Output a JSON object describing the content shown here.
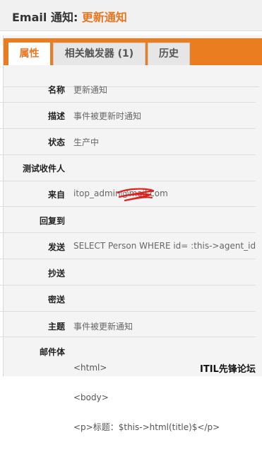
{
  "header": {
    "title_prefix": "Email 通知: ",
    "title_name": "更新通知"
  },
  "tabs": [
    {
      "label": "属性"
    },
    {
      "label": "相关触发器 (1)"
    },
    {
      "label": "历史"
    }
  ],
  "fields": {
    "name": {
      "label": "名称",
      "value": "更新通知"
    },
    "desc": {
      "label": "描述",
      "value": "事件被更新时通知"
    },
    "status": {
      "label": "状态",
      "value": "生产中"
    },
    "test": {
      "label": "测试收件人",
      "value": ""
    },
    "from": {
      "label": "来自",
      "value": "itop_admin@mail.com"
    },
    "reply": {
      "label": "回复到",
      "value": ""
    },
    "to": {
      "label": "发送",
      "value": "SELECT Person WHERE id= :this->agent_id"
    },
    "cc": {
      "label": "抄送",
      "value": ""
    },
    "bcc": {
      "label": "密送",
      "value": ""
    },
    "subject": {
      "label": "主题",
      "value": "事件被更新通知"
    },
    "body": {
      "label": "邮件体",
      "lines": [
        "<html>",
        "<body>",
        "<p>标题：$this->html(title)$</p>"
      ]
    }
  },
  "watermark": "ITIL先锋论坛",
  "colors": {
    "accent": "#e87722",
    "tabbar": "#ea7d1f"
  }
}
